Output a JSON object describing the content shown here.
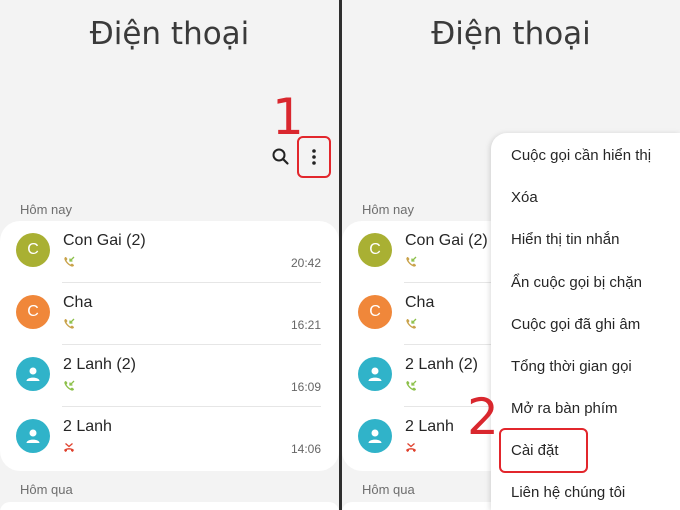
{
  "app_title": "Điện thoại",
  "steps": {
    "one": "1",
    "two": "2"
  },
  "icons": {
    "search": "search-icon",
    "more": "more-vertical-icon",
    "person": "person-icon",
    "incoming": "incoming-call-icon",
    "missed": "missed-call-icon"
  },
  "sections": {
    "today": "Hôm nay",
    "yesterday": "Hôm qua"
  },
  "calls": [
    {
      "initial": "C",
      "name": "Con Gai (2)",
      "time": "20:42",
      "avatar_color": "#a9b033",
      "call_type": "incoming"
    },
    {
      "initial": "C",
      "name": "Cha",
      "time": "16:21",
      "avatar_color": "#f0873a",
      "call_type": "incoming"
    },
    {
      "initial": "",
      "name": "2 Lanh (2)",
      "time": "16:09",
      "avatar_color": "#30b3c9",
      "call_type": "incoming"
    },
    {
      "initial": "",
      "name": "2 Lanh",
      "time": "14:06",
      "avatar_color": "#30b3c9",
      "call_type": "missed"
    }
  ],
  "menu_items": [
    "Cuộc gọi cần hiển thị",
    "Xóa",
    "Hiển thị tin nhắn",
    "Ẩn cuộc gọi bị chặn",
    "Cuộc gọi đã ghi âm",
    "Tổng thời gian gọi",
    "Mở ra bàn phím",
    "Cài đặt",
    "Liên hệ chúng tôi"
  ],
  "colors": {
    "highlight": "#e2262c",
    "step": "#d9272e",
    "incoming": "#8cc04a",
    "missed": "#e0422e"
  }
}
